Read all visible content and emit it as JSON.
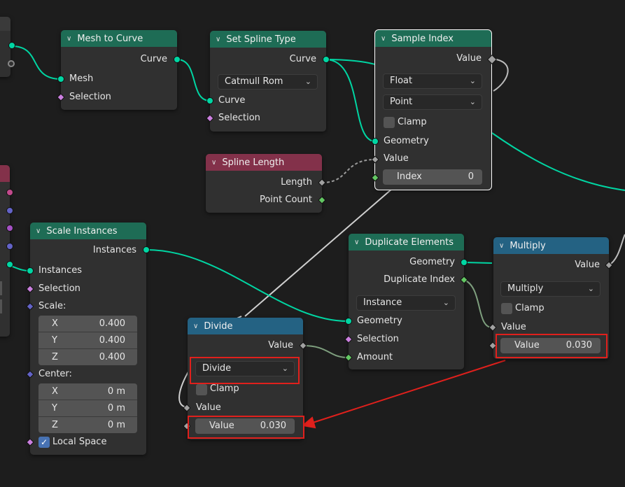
{
  "nodes": {
    "mesh_to_curve": {
      "title": "Mesh to Curve",
      "out_curve": "Curve",
      "in_mesh": "Mesh",
      "in_selection": "Selection"
    },
    "set_spline_type": {
      "title": "Set Spline Type",
      "out_curve": "Curve",
      "type_value": "Catmull Rom",
      "in_curve": "Curve",
      "in_selection": "Selection"
    },
    "sample_index": {
      "title": "Sample Index",
      "out_value": "Value",
      "data_type": "Float",
      "domain": "Point",
      "clamp": "Clamp",
      "in_geometry": "Geometry",
      "in_value": "Value",
      "index_label": "Index",
      "index_value": "0"
    },
    "spline_length": {
      "title": "Spline Length",
      "out_length": "Length",
      "out_point_count": "Point Count"
    },
    "scale_instances": {
      "title": "Scale Instances",
      "out_instances": "Instances",
      "in_instances": "Instances",
      "in_selection": "Selection",
      "scale_label": "Scale:",
      "scale": [
        {
          "axis": "X",
          "value": "0.400"
        },
        {
          "axis": "Y",
          "value": "0.400"
        },
        {
          "axis": "Z",
          "value": "0.400"
        }
      ],
      "center_label": "Center:",
      "center": [
        {
          "axis": "X",
          "value": "0 m"
        },
        {
          "axis": "Y",
          "value": "0 m"
        },
        {
          "axis": "Z",
          "value": "0 m"
        }
      ],
      "local_space": "Local Space"
    },
    "duplicate_elements": {
      "title": "Duplicate Elements",
      "out_geometry": "Geometry",
      "out_duplicate_index": "Duplicate Index",
      "domain": "Instance",
      "in_geometry": "Geometry",
      "in_selection": "Selection",
      "in_amount": "Amount"
    },
    "multiply": {
      "title": "Multiply",
      "out_value": "Value",
      "operation": "Multiply",
      "clamp": "Clamp",
      "in_value": "Value",
      "value_label": "Value",
      "value": "0.030"
    },
    "divide": {
      "title": "Divide",
      "out_value": "Value",
      "operation": "Divide",
      "clamp": "Clamp",
      "in_value": "Value",
      "value_label": "Value",
      "value": "0.030"
    }
  },
  "colors": {
    "geometry_header": "#1e6c55",
    "input_header": "#83314a",
    "math_header": "#246283",
    "annotation": "#e0201c"
  }
}
